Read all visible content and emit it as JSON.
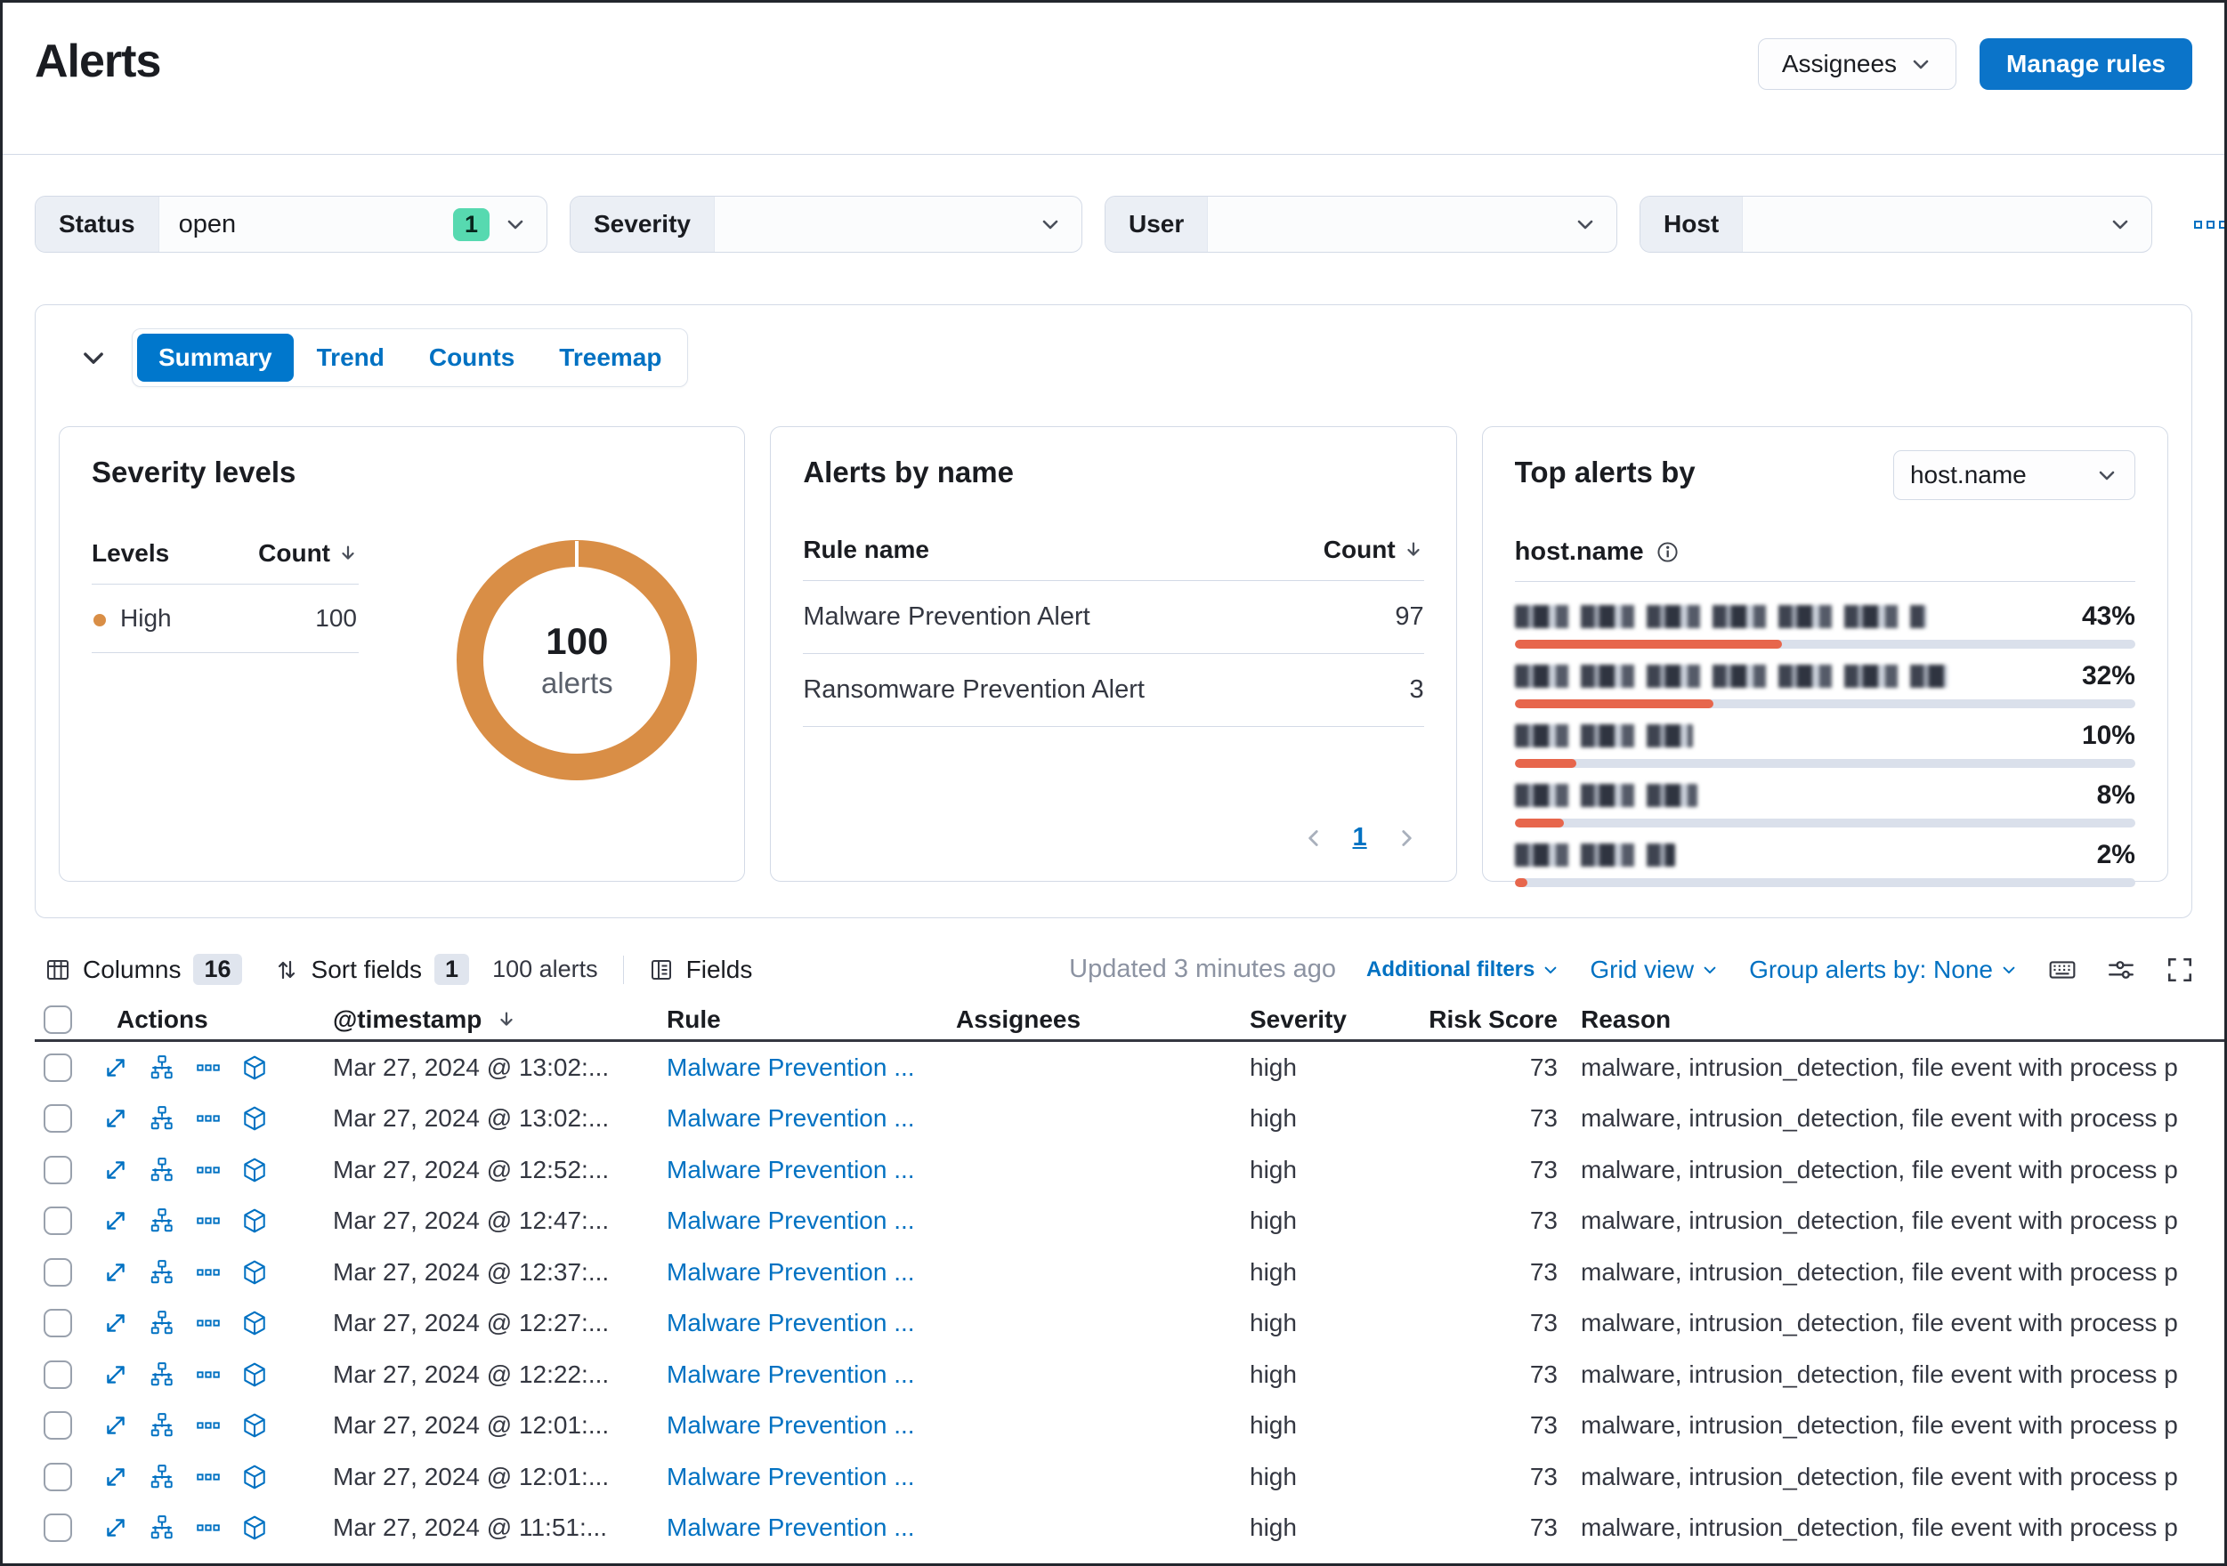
{
  "page": {
    "title": "Alerts"
  },
  "header": {
    "assignees": "Assignees",
    "manage_rules": "Manage rules"
  },
  "filters": {
    "status_label": "Status",
    "status_value": "open",
    "status_badge": "1",
    "severity_label": "Severity",
    "user_label": "User",
    "host_label": "Host"
  },
  "tabs": {
    "items": [
      {
        "label": "Summary"
      },
      {
        "label": "Trend"
      },
      {
        "label": "Counts"
      },
      {
        "label": "Treemap"
      }
    ]
  },
  "severity_card": {
    "title": "Severity levels",
    "col_levels": "Levels",
    "col_count": "Count",
    "level_name": "High",
    "level_count": "100",
    "total": "100",
    "total_label": "alerts",
    "color": "#D98E46"
  },
  "alerts_by_name_card": {
    "title": "Alerts by name",
    "col_rule": "Rule name",
    "col_count": "Count",
    "rows": [
      {
        "name": "Malware Prevention Alert",
        "count": "97"
      },
      {
        "name": "Ransomware Prevention Alert",
        "count": "3"
      }
    ],
    "page": "1"
  },
  "top_alerts_card": {
    "title": "Top alerts by",
    "selector_value": "host.name",
    "field_label": "host.name",
    "items": [
      {
        "pct": "43%",
        "fill": 43,
        "blur": 462
      },
      {
        "pct": "32%",
        "fill": 32,
        "blur": 486
      },
      {
        "pct": "10%",
        "fill": 10,
        "blur": 200
      },
      {
        "pct": "8%",
        "fill": 8,
        "blur": 205
      },
      {
        "pct": "2%",
        "fill": 2,
        "blur": 180
      }
    ]
  },
  "chart_data": [
    {
      "type": "pie",
      "title": "Severity levels",
      "labels": [
        "High"
      ],
      "values": [
        100
      ],
      "center_text": "100 alerts",
      "colors": [
        "#D98E46"
      ]
    },
    {
      "type": "bar",
      "title": "Top alerts by host.name",
      "categories": [
        "redacted-host-1",
        "redacted-host-2",
        "redacted-host-3",
        "redacted-host-4",
        "redacted-host-5"
      ],
      "values": [
        43,
        32,
        10,
        8,
        2
      ],
      "unit": "%",
      "bar_color": "#E7664C"
    }
  ],
  "toolbar": {
    "columns_label": "Columns",
    "columns_count": "16",
    "sort_label": "Sort fields",
    "sort_count": "1",
    "alerts_count": "100 alerts",
    "fields_label": "Fields",
    "updated": "Updated 3 minutes ago",
    "additional_filters": "Additional filters",
    "grid_view": "Grid view",
    "group_by": "Group alerts by: None"
  },
  "table": {
    "columns": [
      "Actions",
      "@timestamp",
      "Rule",
      "Assignees",
      "Severity",
      "Risk Score",
      "Reason"
    ],
    "rows": [
      {
        "ts": "Mar 27, 2024 @ 13:02:...",
        "rule": "Malware Prevention ...",
        "sev": "high",
        "risk": "73",
        "reason": "malware, intrusion_detection, file event with process p"
      },
      {
        "ts": "Mar 27, 2024 @ 13:02:...",
        "rule": "Malware Prevention ...",
        "sev": "high",
        "risk": "73",
        "reason": "malware, intrusion_detection, file event with process p"
      },
      {
        "ts": "Mar 27, 2024 @ 12:52:...",
        "rule": "Malware Prevention ...",
        "sev": "high",
        "risk": "73",
        "reason": "malware, intrusion_detection, file event with process p"
      },
      {
        "ts": "Mar 27, 2024 @ 12:47:...",
        "rule": "Malware Prevention ...",
        "sev": "high",
        "risk": "73",
        "reason": "malware, intrusion_detection, file event with process p"
      },
      {
        "ts": "Mar 27, 2024 @ 12:37:...",
        "rule": "Malware Prevention ...",
        "sev": "high",
        "risk": "73",
        "reason": "malware, intrusion_detection, file event with process p"
      },
      {
        "ts": "Mar 27, 2024 @ 12:27:...",
        "rule": "Malware Prevention ...",
        "sev": "high",
        "risk": "73",
        "reason": "malware, intrusion_detection, file event with process p"
      },
      {
        "ts": "Mar 27, 2024 @ 12:22:...",
        "rule": "Malware Prevention ...",
        "sev": "high",
        "risk": "73",
        "reason": "malware, intrusion_detection, file event with process p"
      },
      {
        "ts": "Mar 27, 2024 @ 12:01:...",
        "rule": "Malware Prevention ...",
        "sev": "high",
        "risk": "73",
        "reason": "malware, intrusion_detection, file event with process p"
      },
      {
        "ts": "Mar 27, 2024 @ 12:01:...",
        "rule": "Malware Prevention ...",
        "sev": "high",
        "risk": "73",
        "reason": "malware, intrusion_detection, file event with process p"
      },
      {
        "ts": "Mar 27, 2024 @ 11:51:...",
        "rule": "Malware Prevention ...",
        "sev": "high",
        "risk": "73",
        "reason": "malware, intrusion_detection, file event with process p"
      }
    ]
  }
}
